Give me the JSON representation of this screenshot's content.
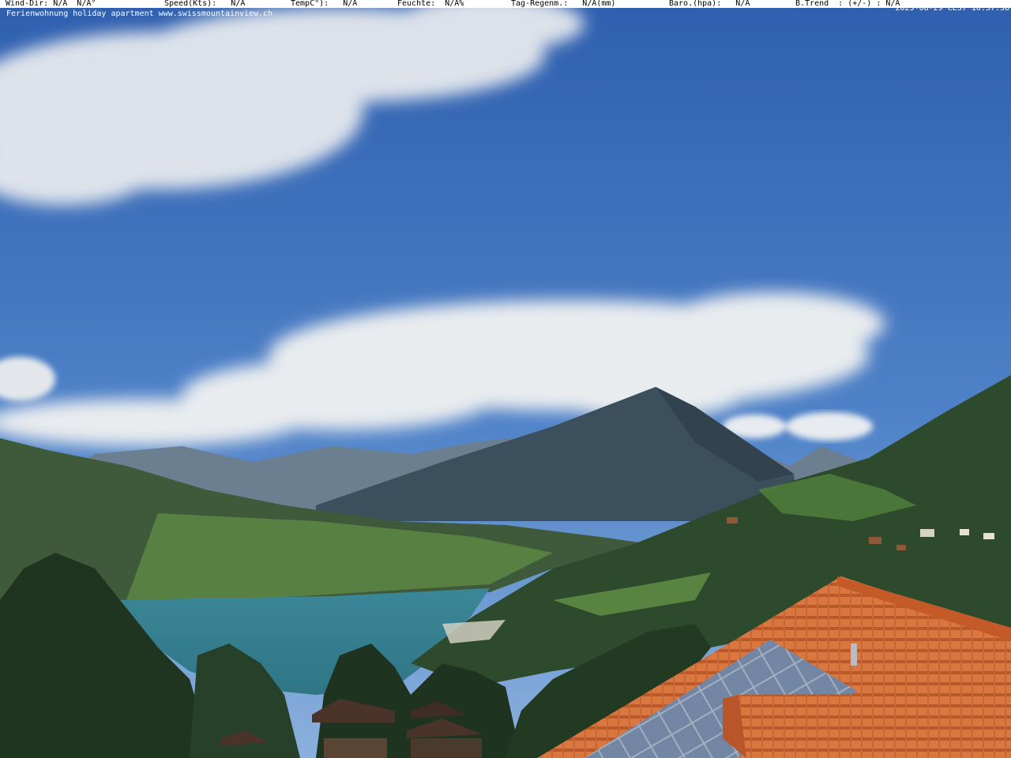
{
  "overlay": {
    "wind_dir": "Wind-Dir: N/A  N/A°",
    "speed": "Speed(Kts):   N/A",
    "temp": "TempC°):   N/A",
    "humidity": "Feuchte:  N/A%",
    "rain": "Tag-Regenm.:   N/A(mm)",
    "baro": "Baro.(hpa):   N/A",
    "trend": "B.Trend  : (+/-) : N/A",
    "caption": "Ferienwohnung holiday apartment www.swissmountainview.ch",
    "timestamp": "2025-08-29 CEST 10:57:38"
  },
  "colors": {
    "sky_top": "#2f5fae",
    "sky_bottom": "#7fa6d8",
    "lake": "#3e8fa0",
    "roof_tiles": "#d9773f",
    "solar_panel": "#6c85a6"
  }
}
